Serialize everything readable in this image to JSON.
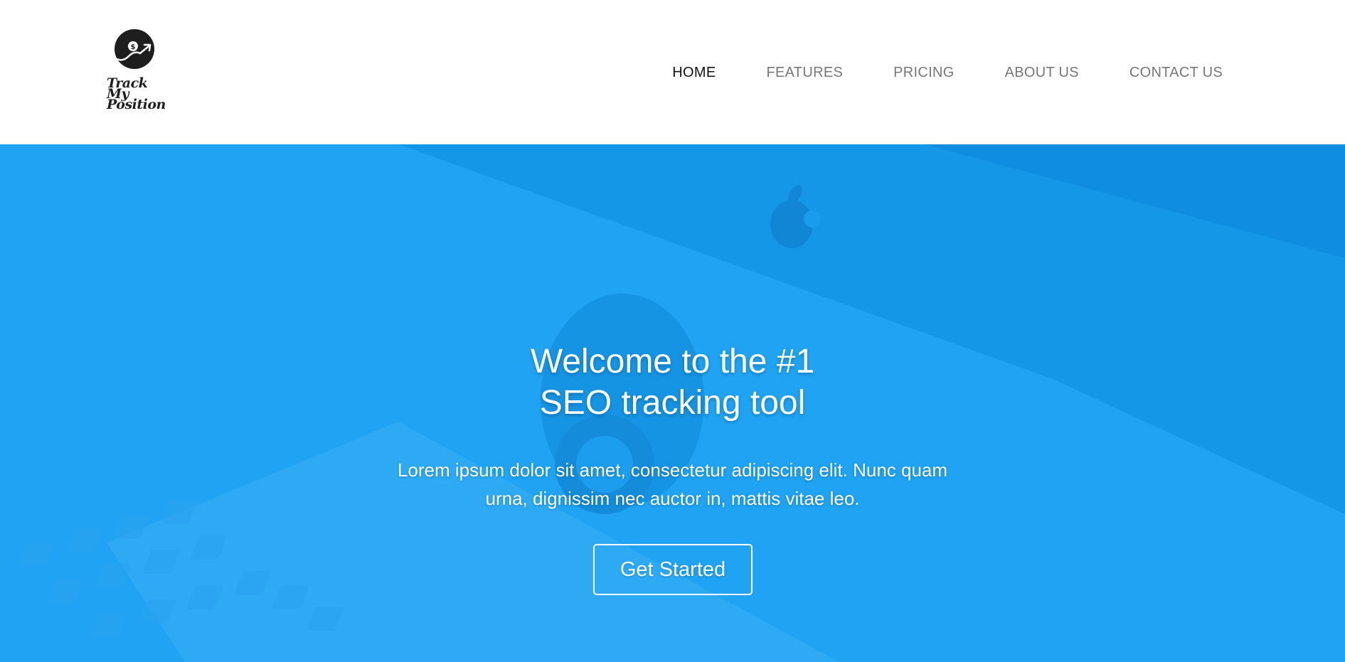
{
  "brand": {
    "logo_lines": [
      "Track",
      "My",
      "Position"
    ],
    "logo_icon": "dollar-growth-icon"
  },
  "nav": {
    "items": [
      {
        "label": "HOME",
        "active": true
      },
      {
        "label": "FEATURES",
        "active": false
      },
      {
        "label": "PRICING",
        "active": false
      },
      {
        "label": "ABOUT US",
        "active": false
      },
      {
        "label": "CONTACT US",
        "active": false
      }
    ]
  },
  "hero": {
    "title_lines": [
      "Welcome to the #1",
      "SEO tracking tool"
    ],
    "text_lines": [
      "Lorem ipsum dolor sit amet, consectetur adipiscing elit. Nunc quam",
      "urna, dignissim nec auctor in, mattis vitae leo."
    ],
    "cta_label": "Get Started",
    "background_image": "desk-with-imac-camera-keyboard"
  },
  "colors": {
    "hero_overlay": "#1fa3f2",
    "nav_active": "#111111",
    "nav_inactive": "#777777",
    "logo": "#1e1e1e"
  }
}
